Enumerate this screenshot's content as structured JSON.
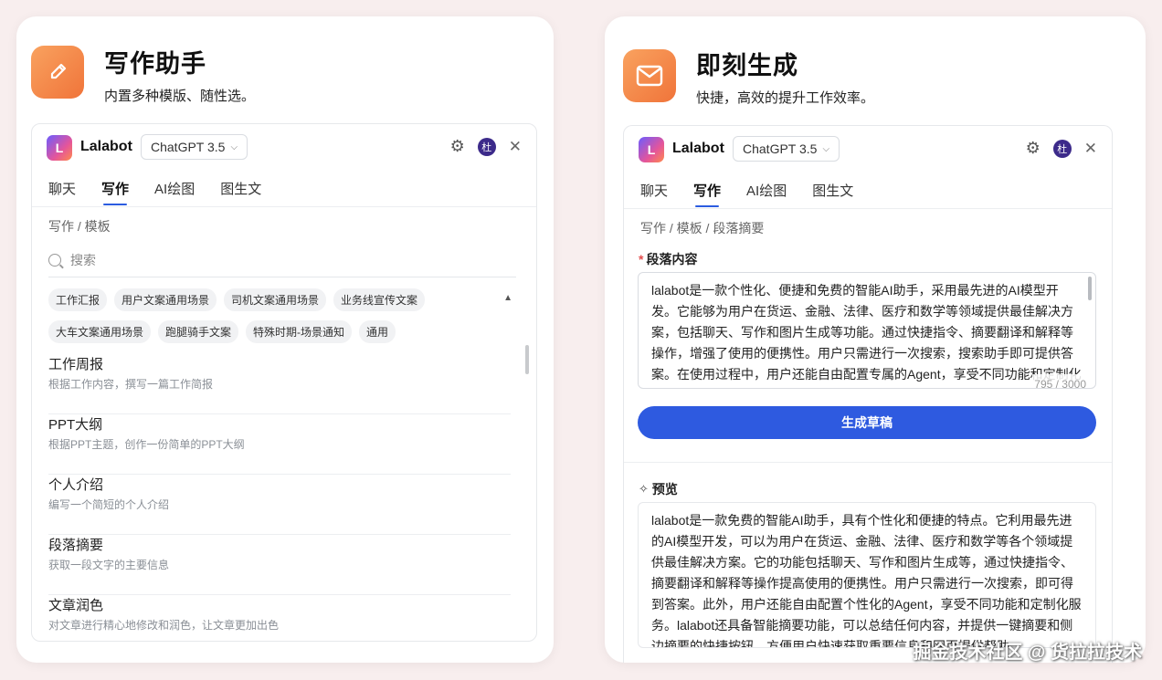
{
  "left": {
    "title": "写作助手",
    "subtitle": "内置多种模版、随性选。",
    "icon": "pencil-icon",
    "panel": {
      "brand": "Lalabot",
      "model": "ChatGPT 3.5",
      "avatar_text": "杜",
      "tabs": [
        "聊天",
        "写作",
        "AI绘图",
        "图生文"
      ],
      "active_tab": "写作",
      "breadcrumb": "写作 / 模板",
      "search_placeholder": "搜索",
      "chips": [
        "工作汇报",
        "用户文案通用场景",
        "司机文案通用场景",
        "业务线宣传文案",
        "大车文案通用场景",
        "跑腿骑手文案",
        "特殊时期-场景通知",
        "通用"
      ],
      "templates": [
        {
          "title": "工作周报",
          "desc": "根据工作内容，撰写一篇工作简报"
        },
        {
          "title": "PPT大纲",
          "desc": "根据PPT主题，创作一份简单的PPT大纲"
        },
        {
          "title": "个人介绍",
          "desc": "编写一个简短的个人介绍"
        },
        {
          "title": "段落摘要",
          "desc": "获取一段文字的主要信息"
        },
        {
          "title": "文章润色",
          "desc": "对文章进行精心地修改和润色，让文章更加出色"
        }
      ]
    }
  },
  "right": {
    "title": "即刻生成",
    "subtitle": "快捷，高效的提升工作效率。",
    "icon": "mail-icon",
    "panel": {
      "brand": "Lalabot",
      "model": "ChatGPT 3.5",
      "avatar_text": "杜",
      "tabs": [
        "聊天",
        "写作",
        "AI绘图",
        "图生文"
      ],
      "active_tab": "写作",
      "breadcrumb": "写作 / 模板 / 段落摘要",
      "field_label": "段落内容",
      "field_value": "lalabot是一款个性化、便捷和免费的智能AI助手，采用最先进的AI模型开发。它能够为用户在货运、金融、法律、医疗和数学等领域提供最佳解决方案，包括聊天、写作和图片生成等功能。通过快捷指令、摘要翻译和解释等操作，增强了使用的便携性。用户只需进行一次搜索，搜索助手即可提供答案。在使用过程中，用户还能自由配置专属的Agent，享受不同功能和定制化服务。此外，lalabot的智能摘要功能可总结任何内容，并提供一键摘要和侧边摘要的快捷按钮。",
      "counter": "795 / 3000",
      "generate_button": "生成草稿",
      "preview_label": "预览",
      "preview_text": "lalabot是一款免费的智能AI助手，具有个性化和便捷的特点。它利用最先进的AI模型开发，可以为用户在货运、金融、法律、医疗和数学等各个领域提供最佳解决方案。它的功能包括聊天、写作和图片生成等，通过快捷指令、摘要翻译和解释等操作提高使用的便携性。用户只需进行一次搜索，即可得到答案。此外，用户还能自由配置个性化的Agent，享受不同功能和定制化服务。lalabot还具备智能摘要功能，可以总结任何内容，并提供一键摘要和侧边摘要的快捷按钮。方便用户快速获取重要信息和网页提供帮助。"
    }
  },
  "watermark": "掘金技术社区 @ 货拉拉技术"
}
